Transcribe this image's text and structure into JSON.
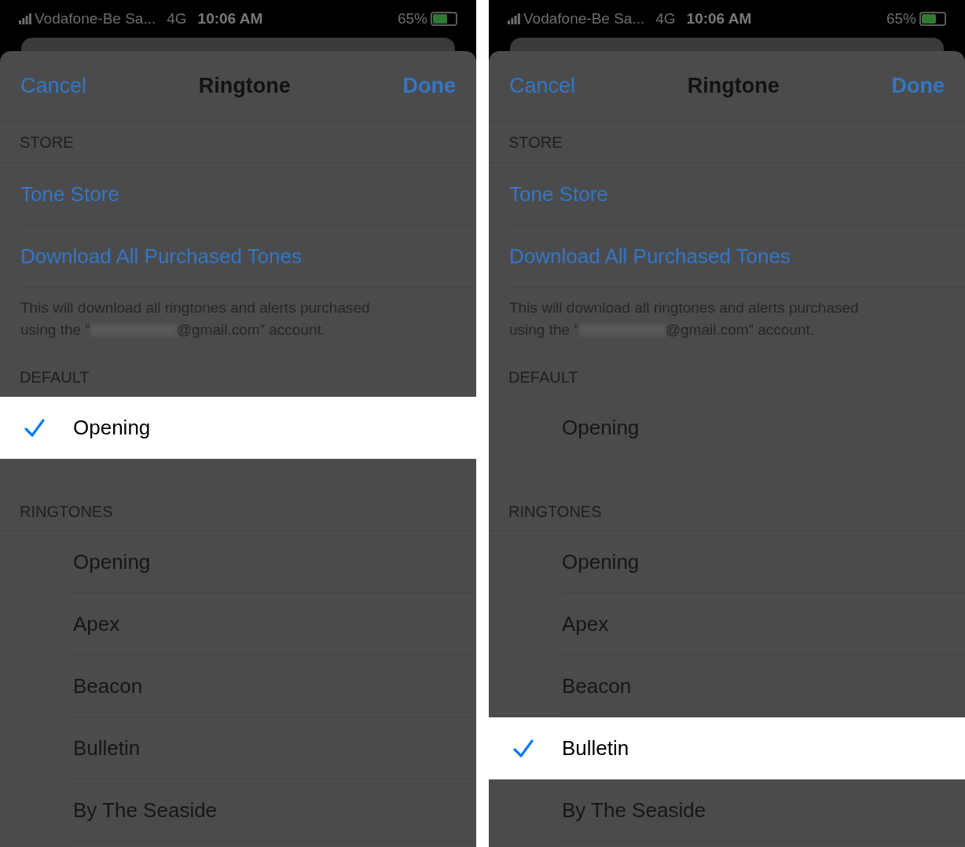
{
  "panels": [
    {
      "status_bar": {
        "carrier": "Vodafone-Be Sa...",
        "network": "4G",
        "time": "10:06 AM",
        "battery": "65%"
      },
      "nav": {
        "cancel": "Cancel",
        "title": "Ringtone",
        "done": "Done"
      },
      "store": {
        "header": "STORE",
        "links": [
          "Tone Store",
          "Download All Purchased Tones"
        ],
        "footer_line": "This will download all ringtones and alerts purchased",
        "footer_before": "using the “",
        "footer_after": "@gmail.com” account."
      },
      "default": {
        "header": "DEFAULT",
        "items": [
          {
            "label": "Opening",
            "selected": true
          }
        ]
      },
      "ringtones": {
        "header": "RINGTONES",
        "items": [
          {
            "label": "Opening",
            "selected": false
          },
          {
            "label": "Apex",
            "selected": false
          },
          {
            "label": "Beacon",
            "selected": false
          },
          {
            "label": "Bulletin",
            "selected": false
          },
          {
            "label": "By The Seaside",
            "selected": false
          }
        ]
      }
    },
    {
      "status_bar": {
        "carrier": "Vodafone-Be Sa...",
        "network": "4G",
        "time": "10:06 AM",
        "battery": "65%"
      },
      "nav": {
        "cancel": "Cancel",
        "title": "Ringtone",
        "done": "Done"
      },
      "store": {
        "header": "STORE",
        "links": [
          "Tone Store",
          "Download All Purchased Tones"
        ],
        "footer_line": "This will download all ringtones and alerts purchased",
        "footer_before": "using the “",
        "footer_after": "@gmail.com” account."
      },
      "default": {
        "header": "DEFAULT",
        "items": [
          {
            "label": "Opening",
            "selected": false
          }
        ]
      },
      "ringtones": {
        "header": "RINGTONES",
        "items": [
          {
            "label": "Opening",
            "selected": false
          },
          {
            "label": "Apex",
            "selected": false
          },
          {
            "label": "Beacon",
            "selected": false
          },
          {
            "label": "Bulletin",
            "selected": true
          },
          {
            "label": "By The Seaside",
            "selected": false
          }
        ]
      }
    }
  ]
}
